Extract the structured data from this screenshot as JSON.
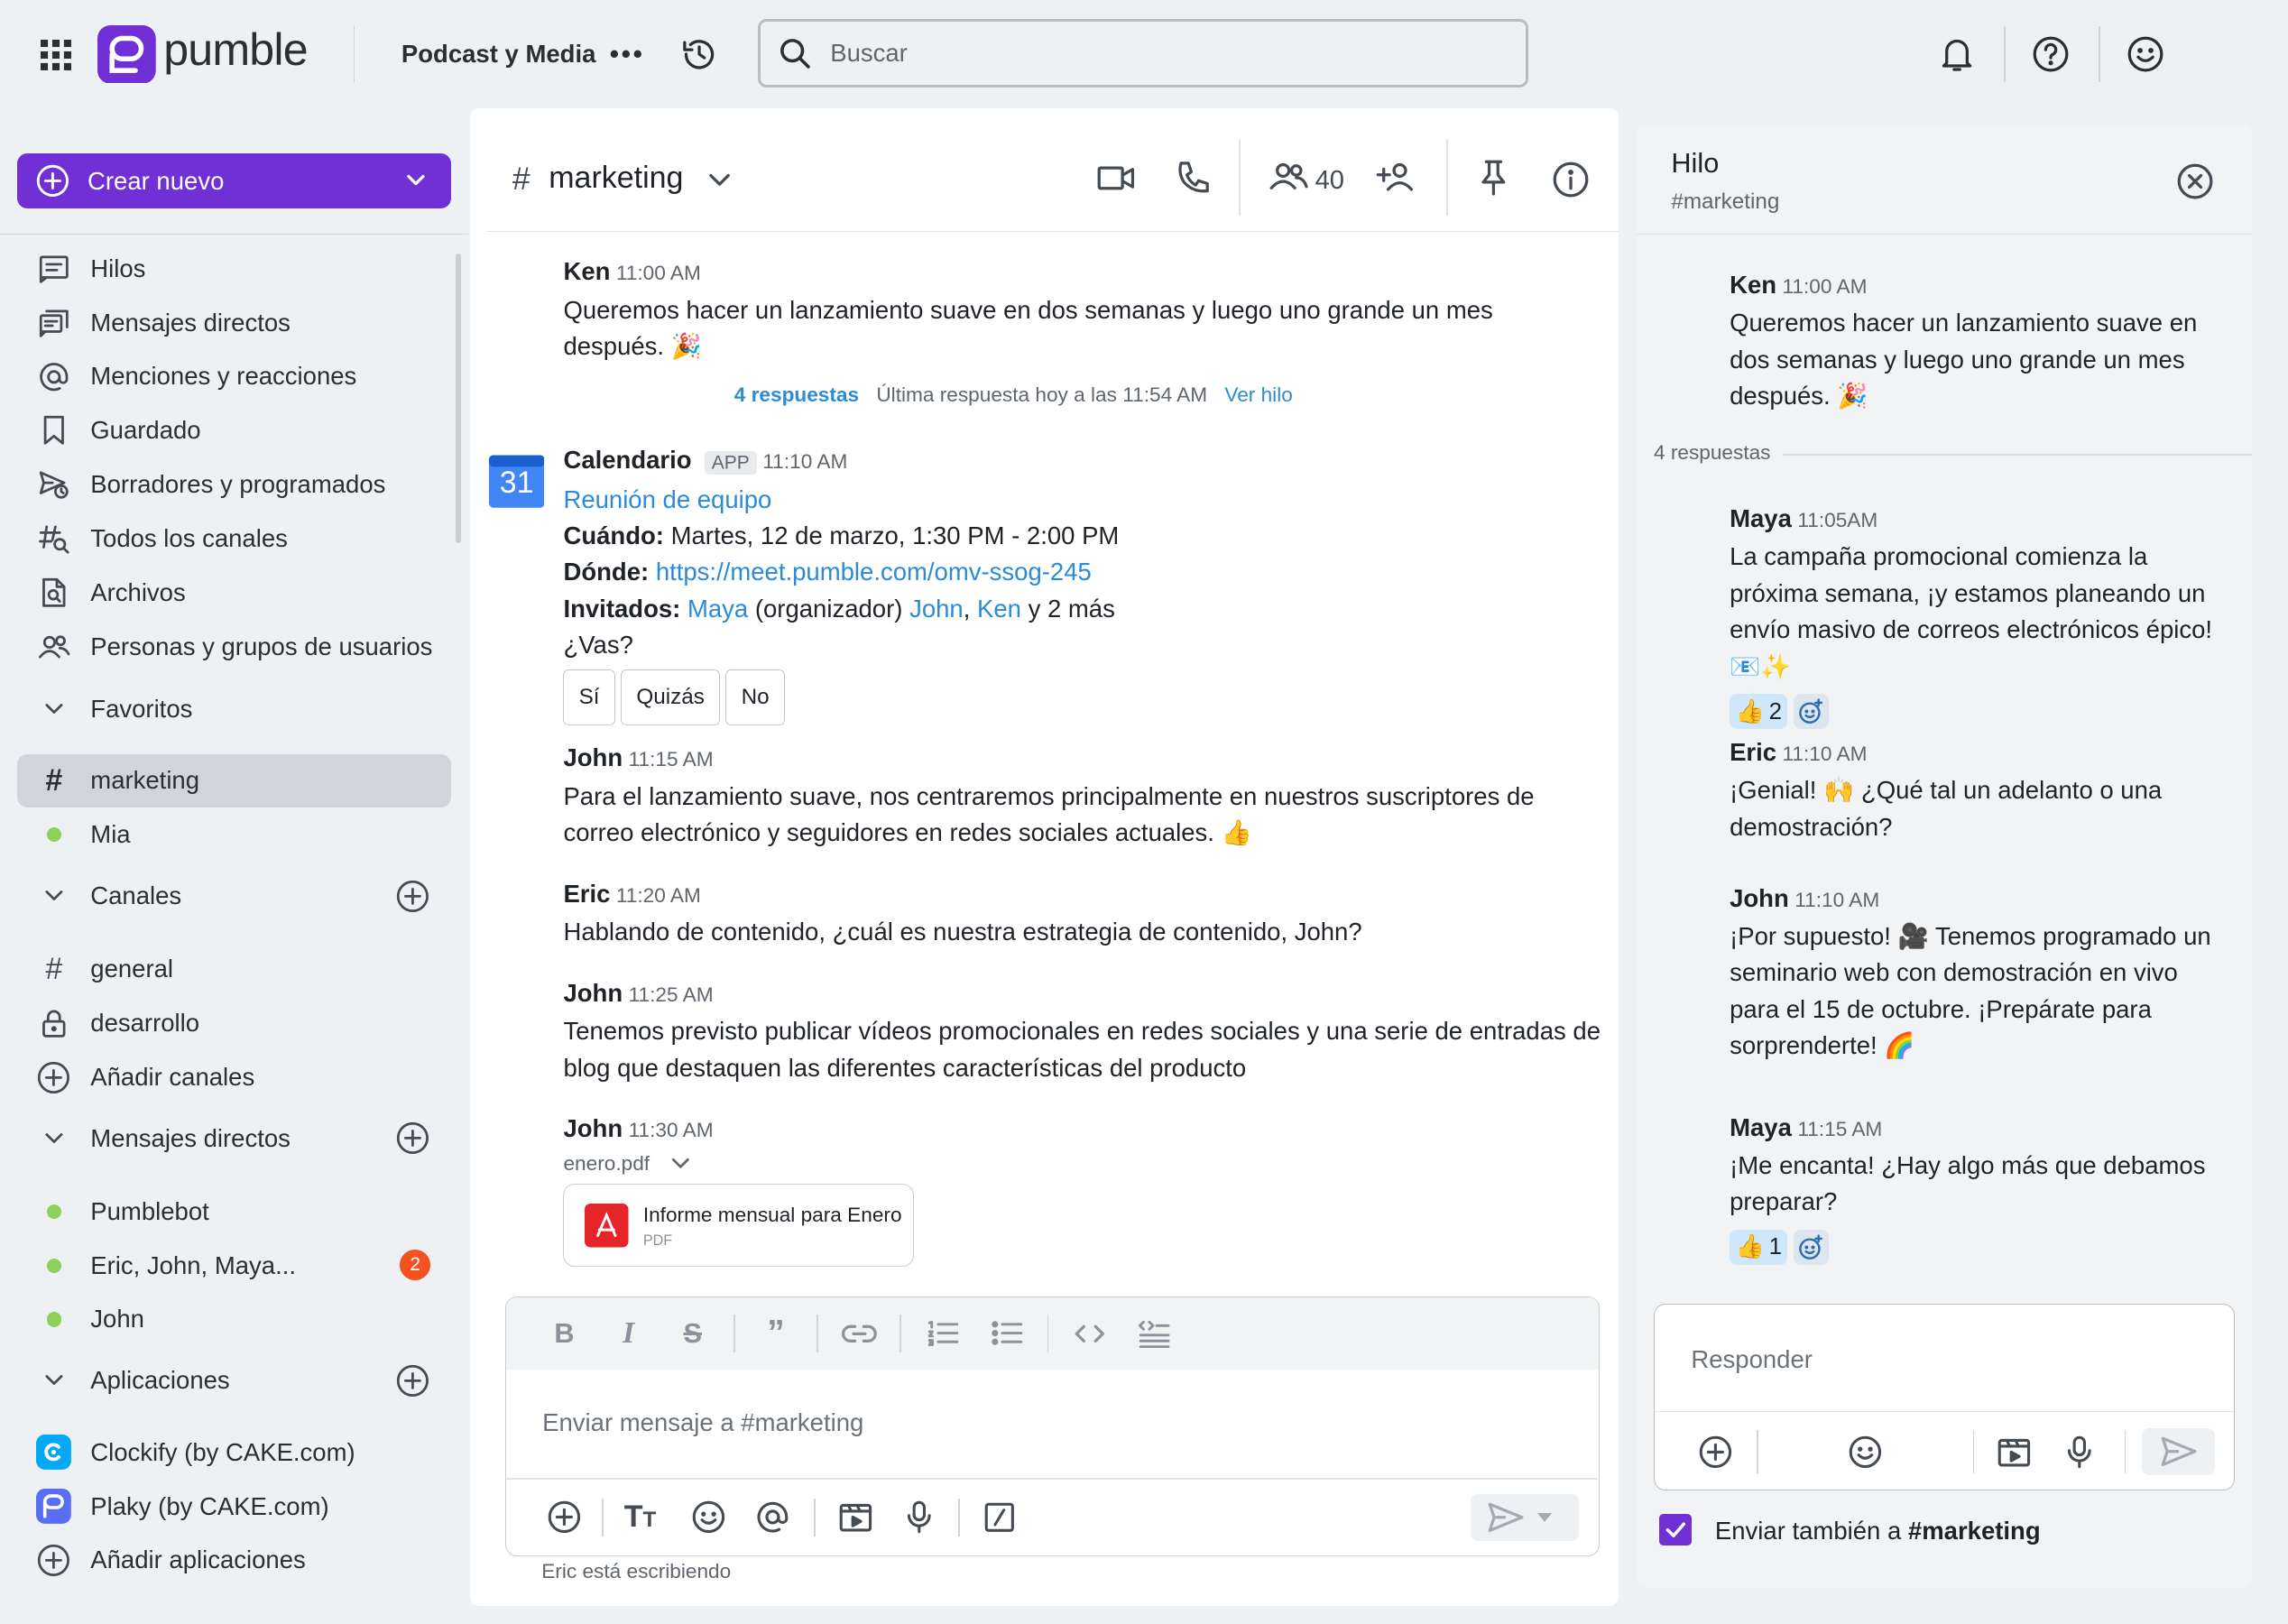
{
  "topbar": {
    "brand": "pumble",
    "workspace": "Podcast y Media",
    "search_placeholder": "Buscar"
  },
  "sidebar": {
    "create_label": "Crear nuevo",
    "nav": [
      "Hilos",
      "Mensajes directos",
      "Menciones y reacciones",
      "Guardado",
      "Borradores y programados",
      "Todos los canales",
      "Archivos",
      "Personas y grupos de usuarios"
    ],
    "favorites_label": "Favoritos",
    "favorites": [
      "marketing",
      "Mia"
    ],
    "channels_label": "Canales",
    "channels": [
      "general",
      "desarrollo"
    ],
    "add_channels": "Añadir canales",
    "dms_label": "Mensajes directos",
    "dms": [
      "Pumblebot",
      "Eric, John, Maya...",
      "John"
    ],
    "dm_badge": "2",
    "apps_label": "Aplicaciones",
    "apps": [
      "Clockify (by CAKE.com)",
      "Plaky (by CAKE.com)"
    ],
    "add_apps": "Añadir aplicaciones"
  },
  "channel": {
    "name": "marketing",
    "members": "40",
    "messages": [
      {
        "author": "Ken",
        "time": "11:00 AM",
        "text": "Queremos hacer un lanzamiento suave en dos semanas y luego uno grande un mes después. 🎉"
      },
      {
        "author": "John",
        "time": "11:15 AM",
        "text": "Para el lanzamiento suave, nos centraremos principalmente en nuestros suscriptores de correo electrónico y seguidores en redes sociales actuales. 👍"
      },
      {
        "author": "Eric",
        "time": "11:20 AM",
        "text": "Hablando de contenido, ¿cuál es nuestra estrategia de contenido, John?"
      },
      {
        "author": "John",
        "time": "11:25 AM",
        "text": "Tenemos previsto publicar vídeos promocionales en redes sociales y una serie de entradas de blog que destaquen las diferentes características del producto"
      },
      {
        "author": "John",
        "time": "11:30 AM"
      }
    ],
    "thread_summary": {
      "replies": "4 respuestas",
      "last": "Última respuesta hoy a las 11:54 AM",
      "view": "Ver hilo"
    },
    "calendar": {
      "icon_day": "31",
      "author": "Calendario",
      "app_tag": "APP",
      "time": "11:10 AM",
      "event": "Reunión de equipo",
      "when_label": "Cuándo:",
      "when": "Martes, 12 de marzo, 1:30 PM - 2:00 PM",
      "where_label": "Dónde:",
      "where": "https://meet.pumble.com/omv-ssog-245",
      "invited_label": "Invitados:",
      "inv1": "Maya",
      "inv1_note": "(organizador)",
      "inv2": "John",
      "inv3": "Ken",
      "inv_more": "y 2 más",
      "question": "¿Vas?",
      "yes": "Sí",
      "maybe": "Quizás",
      "no": "No"
    },
    "file": {
      "name": "enero.pdf",
      "title": "Informe mensual para Enero",
      "type": "PDF"
    },
    "composer_placeholder": "Enviar mensaje a #marketing",
    "typing": "Eric está escribiendo"
  },
  "thread": {
    "title": "Hilo",
    "channel": "#marketing",
    "root": {
      "author": "Ken",
      "time": "11:00 AM",
      "text": "Queremos hacer un lanzamiento suave en dos semanas y luego uno grande un mes después. 🎉"
    },
    "replies_count": "4 respuestas",
    "replies": [
      {
        "author": "Maya",
        "time": "11:05AM",
        "text": "La campaña promocional comienza la próxima semana, ¡y estamos planeando un envío masivo de correos electrónicos épico! 📧✨",
        "reaction": "👍",
        "count": "2"
      },
      {
        "author": "Eric",
        "time": "11:10 AM",
        "text": "¡Genial! 🙌 ¿Qué tal un adelanto o una demostración?"
      },
      {
        "author": "John",
        "time": "11:10 AM",
        "text": "¡Por supuesto! 🎥 Tenemos programado un seminario web con demostración en vivo para el 15 de octubre. ¡Prepárate para sorprenderte! 🌈"
      },
      {
        "author": "Maya",
        "time": "11:15 AM",
        "text": "¡Me encanta! ¿Hay algo más que debamos preparar?",
        "reaction": "👍",
        "count": "1"
      }
    ],
    "reply_placeholder": "Responder",
    "also_send_prefix": "Enviar también a ",
    "also_send_channel": "#marketing"
  },
  "colors": {
    "accent": "#7030d6",
    "link": "#2c8bd9",
    "badge": "#f4511e",
    "online": "#8fd05a"
  }
}
